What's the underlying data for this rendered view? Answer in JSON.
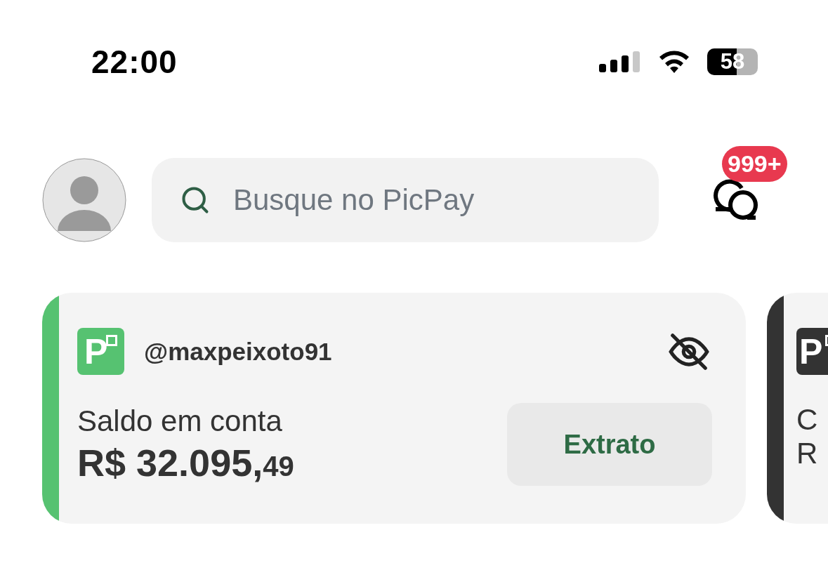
{
  "status_bar": {
    "time": "22:00",
    "battery": "58"
  },
  "header": {
    "search": {
      "placeholder": "Busque no PicPay"
    },
    "messages_badge": "999+"
  },
  "cards": [
    {
      "kind": "account",
      "color": "#56c271",
      "logo": "P",
      "username": "@maxpeixoto91",
      "label": "Saldo em conta",
      "balance": "R$ 32.095,",
      "cents": "49",
      "button": "Extrato"
    },
    {
      "kind": "peek",
      "color": "#333333",
      "logo": "P",
      "label": "C",
      "balance": "R"
    }
  ]
}
